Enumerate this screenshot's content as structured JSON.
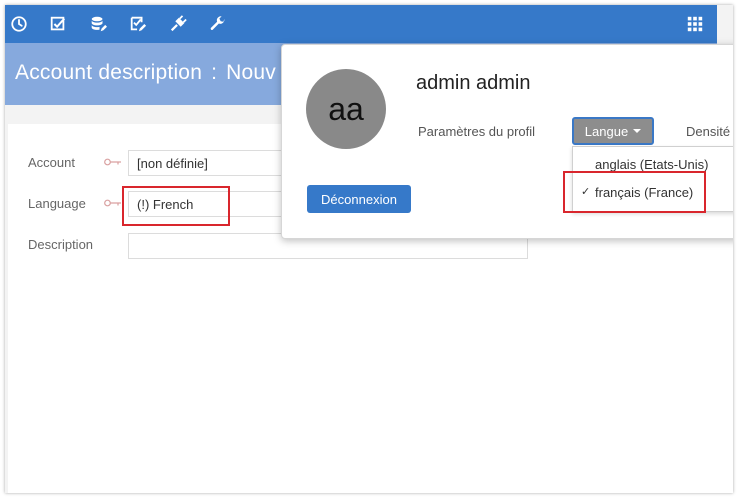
{
  "toolbar": {
    "icons": [
      "clock-icon",
      "checkbox-icon",
      "database-edit-icon",
      "checklist-edit-icon",
      "plug-icon",
      "wrench-icon"
    ],
    "apps_icon": "grid-apps-icon"
  },
  "header": {
    "title": "Account description",
    "separator": ":",
    "subtitle": "Nouv"
  },
  "form": {
    "account_label": "Account",
    "account_value": "[non définie]",
    "language_label": "Language",
    "language_value": "(!) French",
    "description_label": "Description",
    "description_value": ""
  },
  "profile_popup": {
    "avatar_initials": "aa",
    "user_name": "admin admin",
    "profile_settings": "Paramètres du profil",
    "language_button": "Langue",
    "density": "Densité",
    "language_options": [
      {
        "label": "anglais (Etats-Unis)",
        "selected": false
      },
      {
        "label": "français (France)",
        "selected": true
      }
    ],
    "check_mark": "✓",
    "logout": "Déconnexion"
  },
  "colors": {
    "toolbar": "#3679c9",
    "header": "#86a9dd",
    "highlight": "#d9262d",
    "avatar": "#898989",
    "language_button": "#8d8d8d"
  }
}
